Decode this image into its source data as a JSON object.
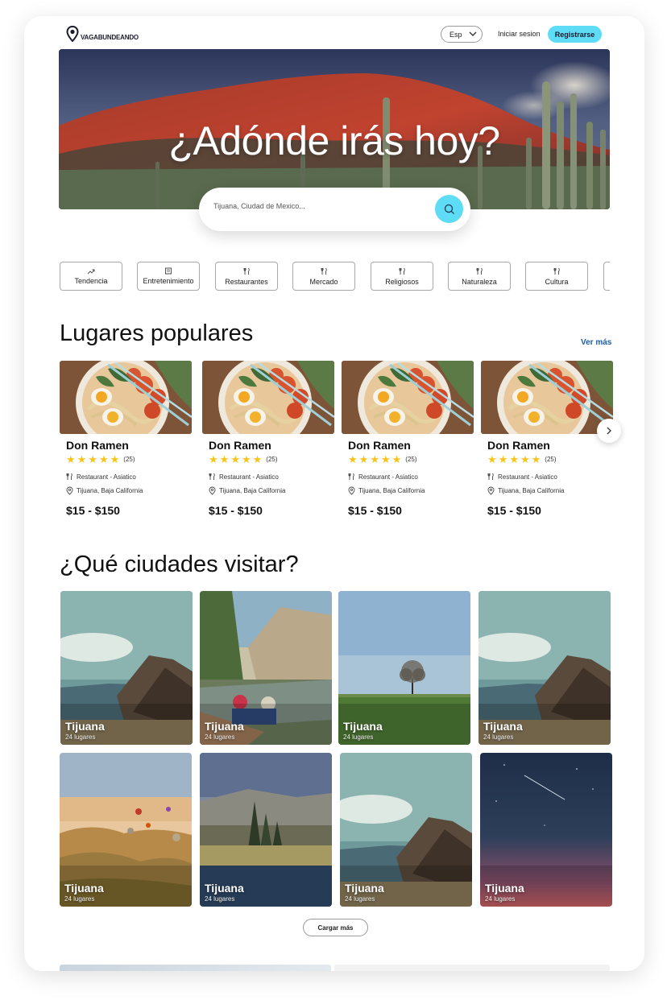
{
  "header": {
    "brand": "VAGABUNDEANDO",
    "language": "Esp",
    "login_label": "Iniciar sesion",
    "register_label": "Registrarse"
  },
  "hero": {
    "title": "¿Adónde irás hoy?",
    "search_placeholder": "Tijuana, Ciudad de Mexico..."
  },
  "categories": [
    {
      "label": "Tendencia",
      "icon": "trending-icon"
    },
    {
      "label": "Entretenimiento",
      "icon": "building-icon"
    },
    {
      "label": "Restaurantes",
      "icon": "utensils-icon"
    },
    {
      "label": "Mercado",
      "icon": "utensils-icon"
    },
    {
      "label": "Religiosos",
      "icon": "utensils-icon"
    },
    {
      "label": "Naturaleza",
      "icon": "utensils-icon"
    },
    {
      "label": "Cultura",
      "icon": "utensils-icon"
    }
  ],
  "popular": {
    "title": "Lugares populares",
    "see_more": "Ver más",
    "items": [
      {
        "name": "Don Ramen",
        "rating_count": "(25)",
        "category": "Restaurant - Asiatico",
        "location": "Tijuana, Baja California",
        "price": "$15 - $150",
        "stars": 5
      },
      {
        "name": "Don Ramen",
        "rating_count": "(25)",
        "category": "Restaurant - Asiatico",
        "location": "Tijuana, Baja California",
        "price": "$15 - $150",
        "stars": 5
      },
      {
        "name": "Don Ramen",
        "rating_count": "(25)",
        "category": "Restaurant - Asiatico",
        "location": "Tijuana, Baja California",
        "price": "$15 - $150",
        "stars": 5
      },
      {
        "name": "Don Ramen",
        "rating_count": "(25)",
        "category": "Restaurant - Asiatico",
        "location": "Tijuana, Baja California",
        "price": "$15 - $150",
        "stars": 5
      }
    ]
  },
  "cities": {
    "title": "¿Qué ciudades visitar?",
    "items": [
      {
        "name": "Tijuana",
        "count": "24 lugares"
      },
      {
        "name": "Tijuana",
        "count": "24 lugares"
      },
      {
        "name": "Tijuana",
        "count": "24 lugares"
      },
      {
        "name": "Tijuana",
        "count": "24 lugares"
      },
      {
        "name": "Tijuana",
        "count": "24 lugares"
      },
      {
        "name": "Tijuana",
        "count": "24 lugares"
      },
      {
        "name": "Tijuana",
        "count": "24 lugares"
      },
      {
        "name": "Tijuana",
        "count": "24 lugares"
      }
    ],
    "load_more": "Cargar más"
  },
  "colors": {
    "accent": "#5fdcf5",
    "star": "#f5c518",
    "link": "#1f5fa8"
  }
}
